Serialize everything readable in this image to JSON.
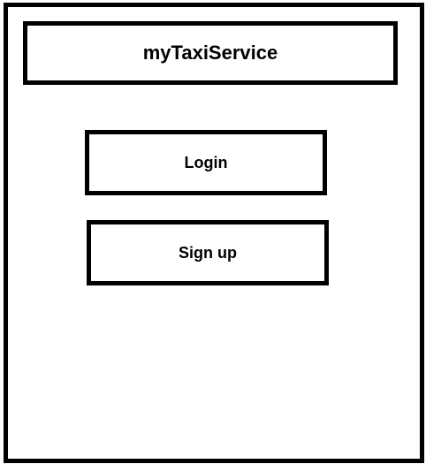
{
  "app": {
    "title": "myTaxiService"
  },
  "actions": {
    "login_label": "Login",
    "signup_label": "Sign up"
  },
  "colors": {
    "border": "#000000",
    "background": "#ffffff",
    "text": "#000000"
  }
}
